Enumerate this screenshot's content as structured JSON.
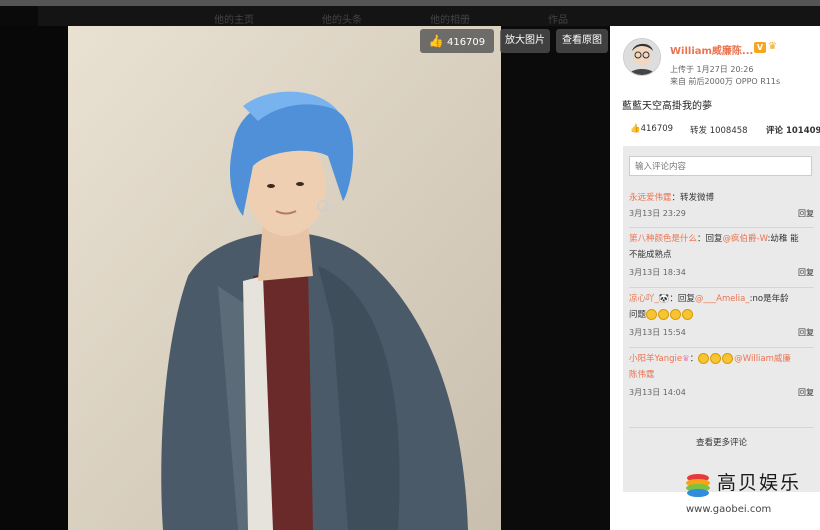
{
  "nav": {
    "items": [
      "他的主页",
      "他的头条",
      "他的相册",
      "作品"
    ]
  },
  "toolbar": {
    "like_count": "416709",
    "zoom_label": "放大图片",
    "original_label": "查看原图"
  },
  "post": {
    "username": "William威廉陈...",
    "badge": "V",
    "upload_time": "上传于 1月27日 20:26",
    "source": "来自 前后2000万 OPPO R11s",
    "text": "藍藍天空高掛我的夢"
  },
  "stats": {
    "likes": "416709",
    "repost": "转发 1008458",
    "comment": "评论 101409"
  },
  "comment_input": {
    "placeholder": "输入评论内容"
  },
  "comments": [
    {
      "user": "永远爱伟霆",
      "text": "：转发微博",
      "date": "3月13日 23:29",
      "reply": "回复"
    },
    {
      "user": "第八种颜色是什么",
      "text_a": "：回复",
      "mention": "@疯伯爵-W",
      "text_b": ":幼稚 能",
      "line2": "不能成熟点",
      "date": "3月13日 18:34",
      "reply": "回复"
    },
    {
      "user": "凉心吖_",
      "text_a": "：回复",
      "mention": "@___Amelia_",
      "text_b": ":no是年龄",
      "line2": "问题",
      "date": "3月13日 15:54",
      "reply": "回复"
    },
    {
      "user": "小阳羊Yangie",
      "mention": "@William威廉",
      "line2": "陈伟霆",
      "date": "3月13日 14:04",
      "reply": "回复"
    }
  ],
  "more_comments": "查看更多评论",
  "watermark": {
    "brand": "高贝娱乐",
    "url": "www.gaobei.com"
  },
  "colors": {
    "accent": "#eb7350",
    "panel": "#ffffff",
    "comment_bg": "#eaeaea"
  }
}
